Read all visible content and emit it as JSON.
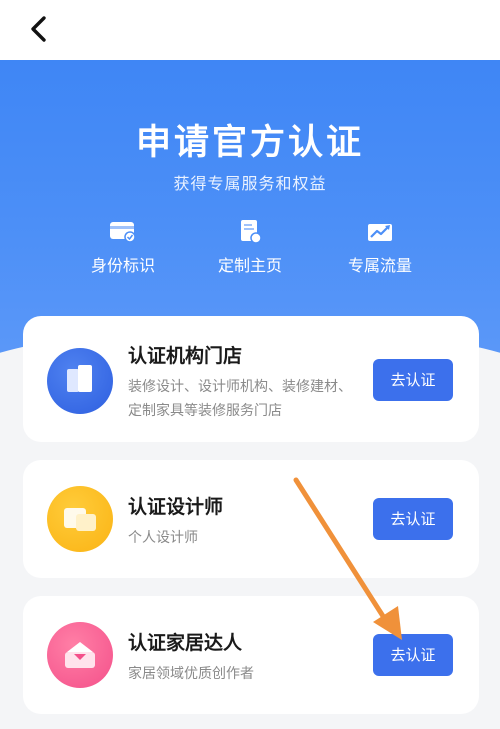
{
  "nav": {
    "back_icon": "chevron-left-icon"
  },
  "hero": {
    "title": "申请官方认证",
    "subtitle": "获得专属服务和权益",
    "benefits": [
      {
        "label": "身份标识",
        "icon": "id-card-icon"
      },
      {
        "label": "定制主页",
        "icon": "custom-page-icon"
      },
      {
        "label": "专属流量",
        "icon": "traffic-trend-icon"
      }
    ]
  },
  "cards": [
    {
      "title": "认证机构门店",
      "description": "装修设计、设计师机构、装修建材、定制家具等装修服务门店",
      "button": "去认证",
      "icon": "store-icon",
      "color": "#3467e6"
    },
    {
      "title": "认证设计师",
      "description": "个人设计师",
      "button": "去认证",
      "icon": "designer-icon",
      "color": "#fbbd22"
    },
    {
      "title": "认证家居达人",
      "description": "家居领域优质创作者",
      "button": "去认证",
      "icon": "home-expert-icon",
      "color": "#f65d92"
    }
  ],
  "annotation": {
    "type": "arrow",
    "color": "#f0913a",
    "points_to": "认证家居达人 去认证"
  }
}
